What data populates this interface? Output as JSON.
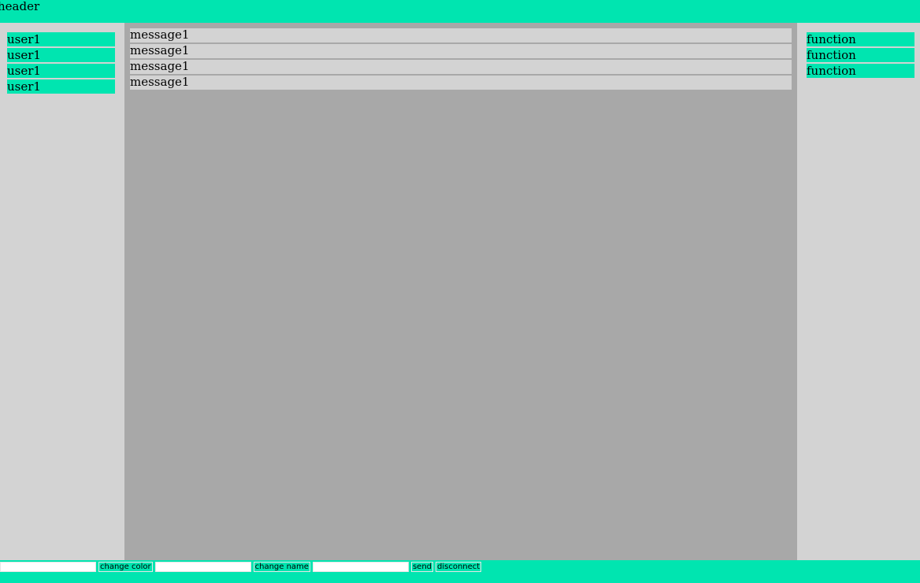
{
  "header": {
    "title": "header"
  },
  "users": [
    "user1",
    "user1",
    "user1",
    "user1"
  ],
  "messages": [
    "message1",
    "message1",
    "message1",
    "message1"
  ],
  "functions": [
    "function",
    "function",
    "function"
  ],
  "footer": {
    "color_input": {
      "value": "",
      "placeholder": ""
    },
    "change_color_label": "change color",
    "name_input": {
      "value": "",
      "placeholder": ""
    },
    "change_name_label": "change name",
    "message_input": {
      "value": "",
      "placeholder": ""
    },
    "send_label": "send",
    "disconnect_label": "disconnect"
  },
  "colors": {
    "accent": "#00e5b0",
    "panel": "#d3d3d3",
    "chat_bg": "#a8a8a8"
  }
}
